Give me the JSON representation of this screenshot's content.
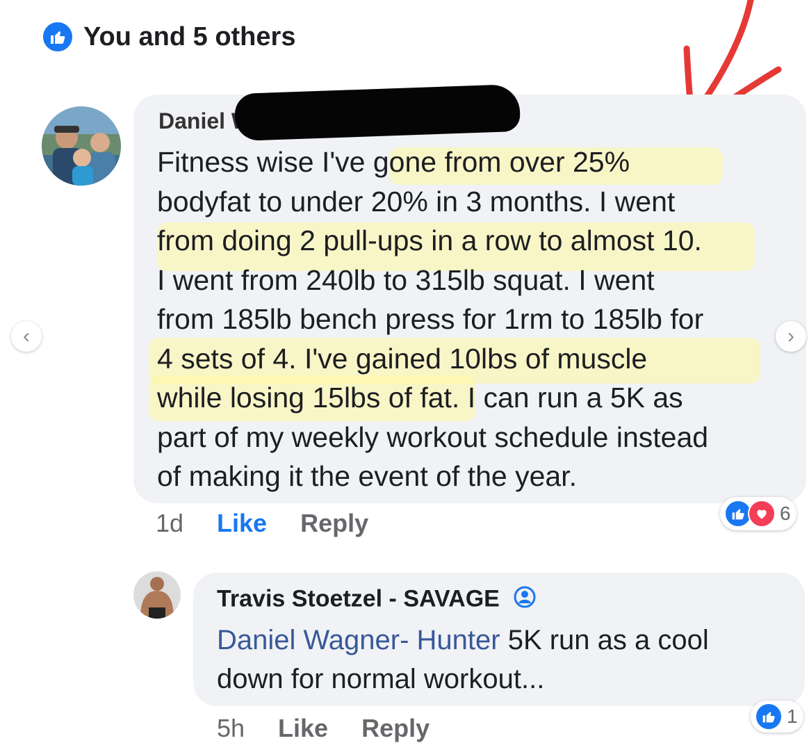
{
  "likes_summary": {
    "text": "You and 5 others",
    "icon": "like-icon"
  },
  "comment": {
    "author": "Daniel Wagner- Hunter",
    "author_visible": "Daniel W",
    "text_lines": [
      "Fitness wise I've gone from over 25%",
      "bodyfat to under 20% in 3 months. I went",
      "from doing 2 pull-ups in a row to almost 10.",
      "I went from 240lb to 315lb squat. I went",
      "from 185lb bench press for 1rm to 185lb for",
      "4 sets of 4. I've gained 10lbs of muscle",
      "while losing 15lbs of fat. I can run a 5K as",
      "part of my weekly workout schedule instead",
      "of making it the event of the year."
    ],
    "time": "1d",
    "like_label": "Like",
    "reply_label": "Reply",
    "reaction_count": "6",
    "reaction_icons": [
      "like-icon",
      "love-icon"
    ]
  },
  "reply": {
    "author": "Travis Stoetzel - SAVAGE",
    "mention": "Daniel Wagner- Hunter",
    "text_line1": " 5K run as a cool",
    "text_line2": "down for normal workout...",
    "time": "5h",
    "like_label": "Like",
    "reply_label": "Reply",
    "reaction_count": "1",
    "reaction_icons": [
      "like-icon"
    ]
  },
  "carousel": {
    "prev": "‹",
    "next": "›"
  },
  "colors": {
    "accent": "#1877f2",
    "bubble": "#f0f2f5",
    "love": "#f33e58",
    "mention": "#385898",
    "annotation": "#e53935"
  }
}
